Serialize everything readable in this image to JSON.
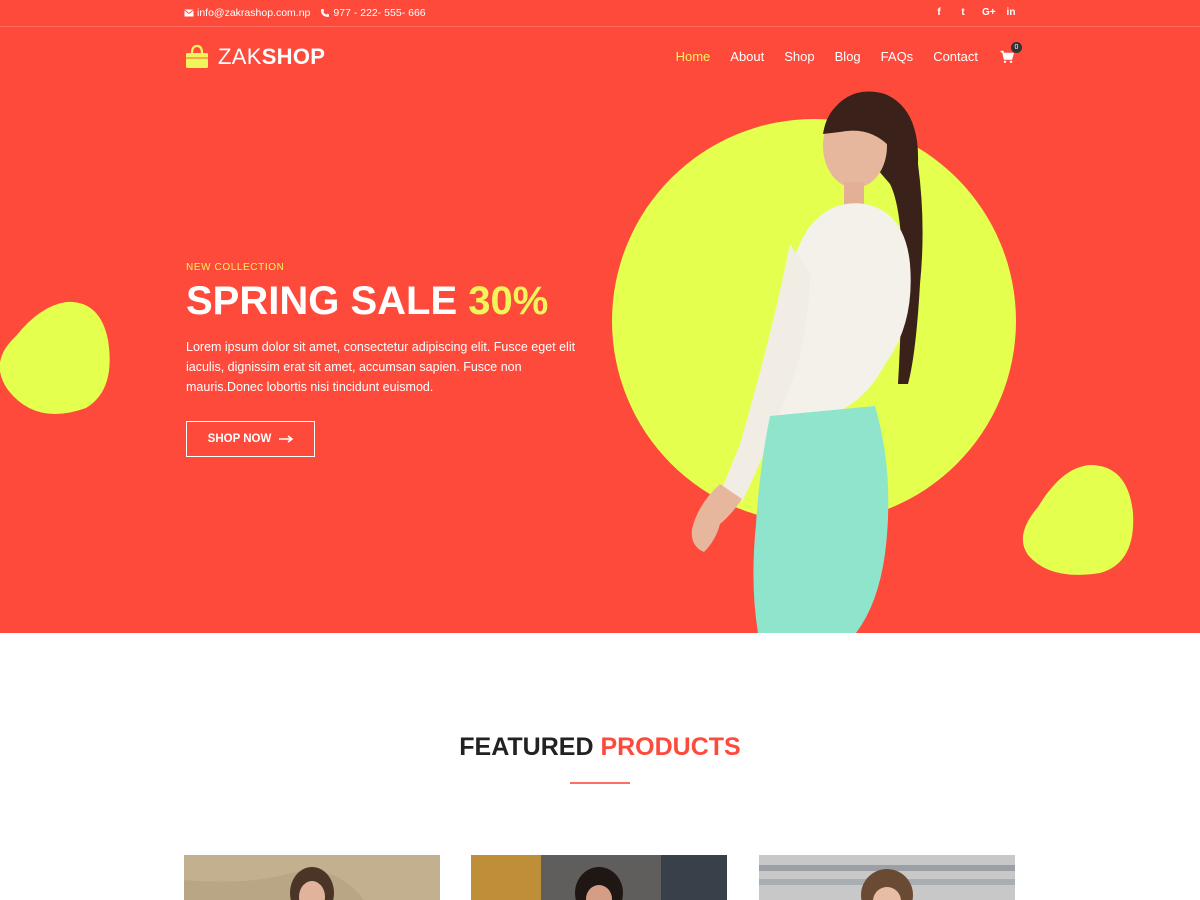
{
  "topbar": {
    "email": "info@zakrashop.com.np",
    "phone": "977 - 222- 555- 666",
    "social": [
      {
        "icon": "facebook-icon",
        "glyph": "f"
      },
      {
        "icon": "twitter-icon",
        "glyph": "t"
      },
      {
        "icon": "google-plus-icon",
        "glyph": "G+"
      },
      {
        "icon": "linkedin-icon",
        "glyph": "in"
      }
    ]
  },
  "logo": {
    "light": "ZAK",
    "bold": "SHOP"
  },
  "nav": {
    "items": [
      {
        "label": "Home",
        "active": true
      },
      {
        "label": "About"
      },
      {
        "label": "Shop"
      },
      {
        "label": "Blog"
      },
      {
        "label": "FAQs"
      },
      {
        "label": "Contact"
      }
    ],
    "cart_count": "0"
  },
  "hero": {
    "eyebrow": "NEW COLLECTION",
    "title": "SPRING SALE ",
    "title_highlight": "30%",
    "body": "Lorem ipsum dolor sit amet, consectetur adipiscing elit. Fusce eget elit iaculis, dignissim erat sit amet, accumsan sapien. Fusce non mauris.Donec lobortis nisi tincidunt euismod.",
    "button": "SHOP NOW"
  },
  "featured": {
    "title": "FEATURED ",
    "title_highlight": "PRODUCTS"
  },
  "colors": {
    "primary": "#fd4a3b",
    "accent": "#e5ff4f",
    "highlight_text": "#f2f55a"
  }
}
